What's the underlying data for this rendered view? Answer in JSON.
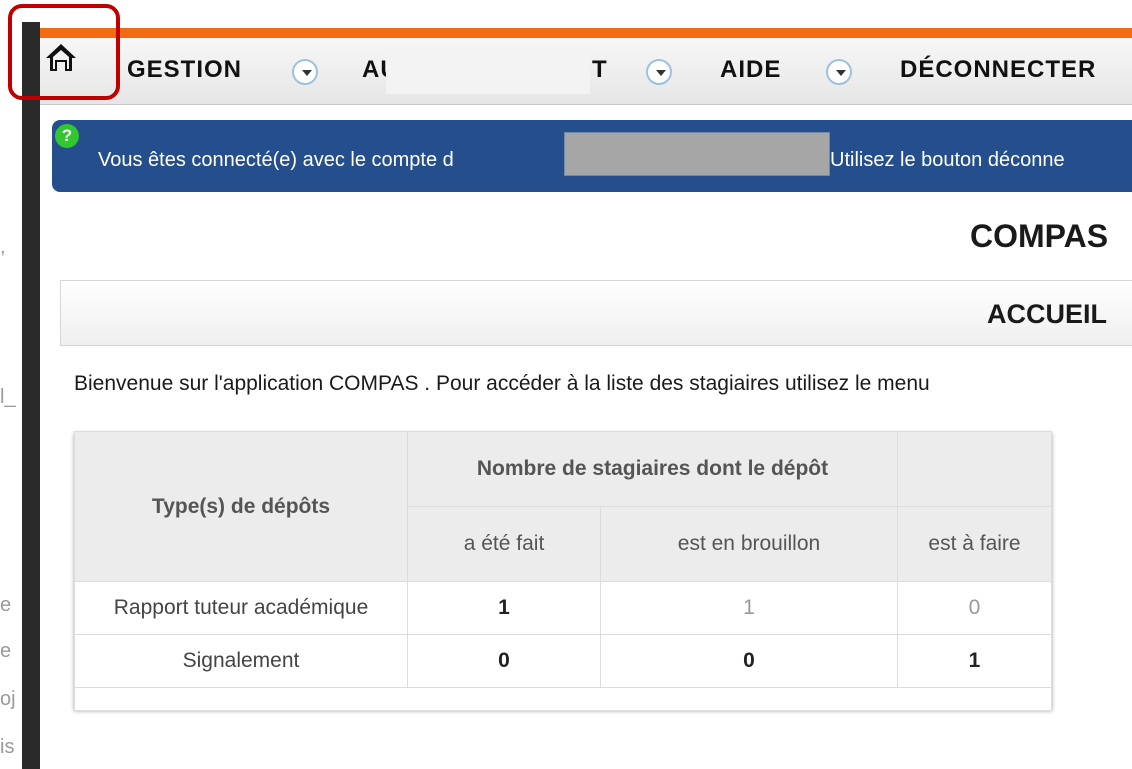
{
  "nav": {
    "items": [
      {
        "label": "GESTION"
      },
      {
        "label": "AU"
      },
      {
        "label": "T"
      },
      {
        "label": "AIDE"
      },
      {
        "label": "DÉCONNECTER"
      }
    ]
  },
  "banner": {
    "badge": "?",
    "text_before": "Vous êtes connecté(e) avec le compte d",
    "text_after": "Utilisez le bouton déconne"
  },
  "app_title": "COMPAS",
  "section_title": "ACCUEIL",
  "welcome_text": "Bienvenue sur l'application COMPAS . Pour accéder à la liste des stagiaires utilisez le menu",
  "table": {
    "header_type": "Type(s) de dépôts",
    "header_group": "Nombre de stagiaires dont le dépôt",
    "sub_headers": [
      "a été fait",
      "est en brouillon",
      "est à faire"
    ],
    "rows": [
      {
        "name": "Rapport tuteur académique",
        "values": [
          "1",
          "1",
          "0"
        ]
      },
      {
        "name": "Signalement",
        "values": [
          "0",
          "0",
          "1"
        ]
      }
    ]
  },
  "left_edge_fragments": [
    ",",
    "l_",
    "e",
    "e",
    "oj",
    "is"
  ],
  "colors": {
    "accent_orange": "#f26a11",
    "banner_blue": "#244f8c",
    "highlight_red": "#c00000",
    "help_green": "#32c72f"
  },
  "icons": [
    "home-icon",
    "chevron-down-icon",
    "help-icon"
  ]
}
